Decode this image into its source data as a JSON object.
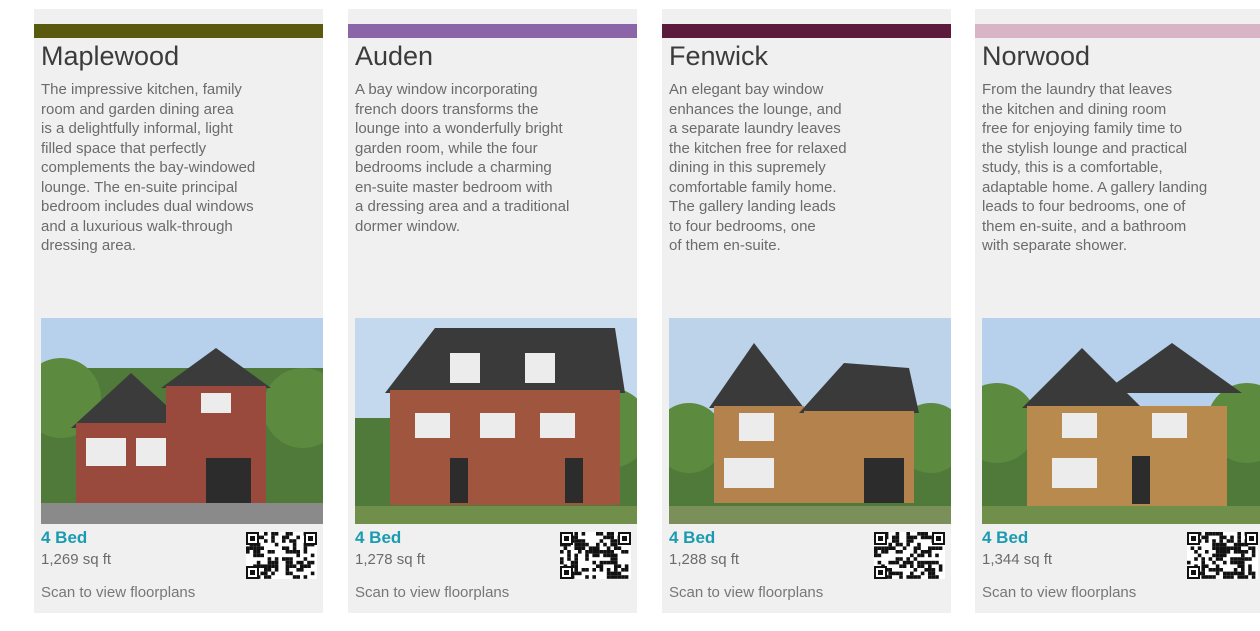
{
  "cards": [
    {
      "title": "Maplewood",
      "accent": "#5a5a0e",
      "description": "The impressive kitchen, family\nroom and garden dining area\nis a delightfully informal, light\nfilled space that perfectly\ncomplements the bay-windowed\nlounge. The en-suite principal\nbedroom includes dual windows\nand a luxurious walk-through\ndressing area.",
      "bedrooms": "4 Bed",
      "area": "1,269 sq ft",
      "scan_text": "Scan to view floorplans",
      "brick_color": "#9a4a3c",
      "icon": "house-photo"
    },
    {
      "title": "Auden",
      "accent": "#8c65a8",
      "description": "A bay window incorporating\nfrench doors transforms the\nlounge into a wonderfully bright\ngarden room, while the four\nbedrooms include a charming\nen-suite master bedroom with\na dressing area and a traditional\ndormer window.",
      "bedrooms": "4 Bed",
      "area": "1,278 sq ft",
      "scan_text": "Scan to view floorplans",
      "brick_color": "#a0553f",
      "icon": "house-photo"
    },
    {
      "title": "Fenwick",
      "accent": "#5c1a3c",
      "description": "An elegant bay window\nenhances the lounge, and\na separate laundry leaves\nthe kitchen free for relaxed\ndining in this supremely\ncomfortable family home.\nThe gallery landing leads\nto four bedrooms, one\nof them en-suite.",
      "bedrooms": "4 Bed",
      "area": "1,288 sq ft",
      "scan_text": "Scan to view floorplans",
      "brick_color": "#b4824c",
      "icon": "house-photo"
    },
    {
      "title": "Norwood",
      "accent": "#d9b3c6",
      "description": "From the laundry that leaves\nthe kitchen and dining room\nfree for enjoying family time to\nthe stylish lounge and practical\nstudy, this is a comfortable,\nadaptable home. A gallery landing\nleads to four bedrooms, one of\nthem en-suite, and a bathroom\nwith separate shower.",
      "bedrooms": "4 Bed",
      "area": "1,344 sq ft",
      "scan_text": "Scan to view floorplans",
      "brick_color": "#b98a4e",
      "icon": "house-photo"
    }
  ]
}
